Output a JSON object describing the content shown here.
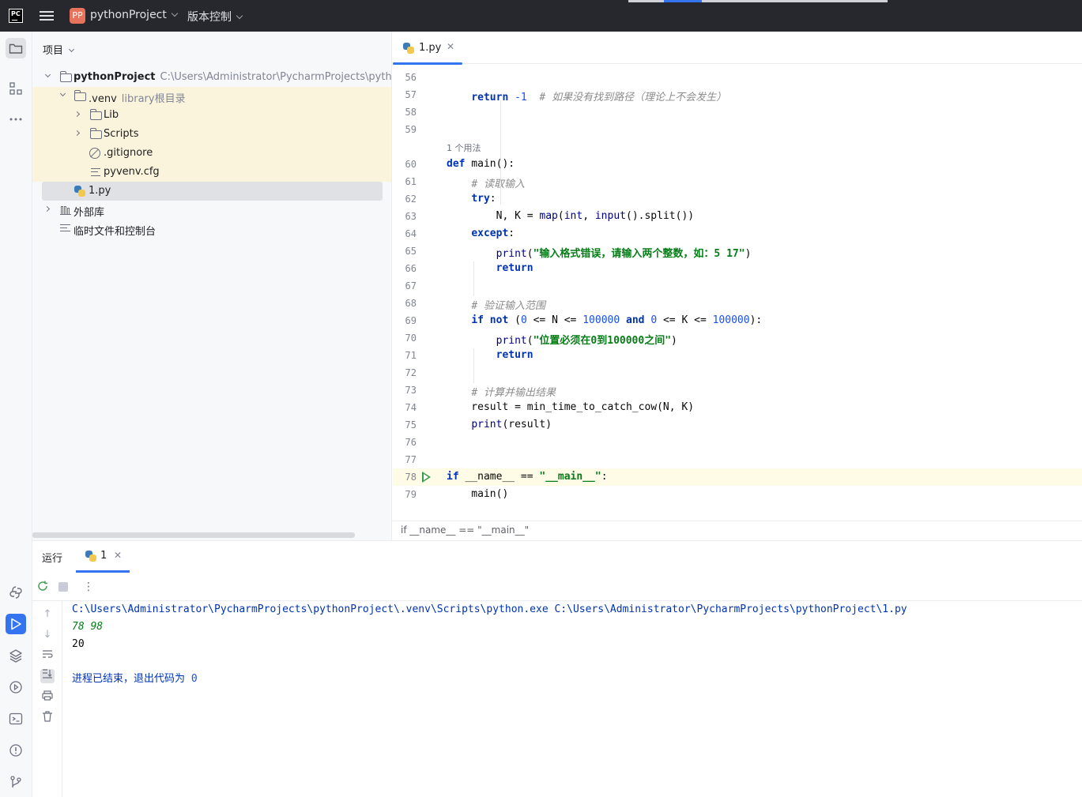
{
  "app": {
    "logo_text": "PC",
    "project_badge": "PP",
    "project_name": "pythonProject",
    "vcs_menu": "版本控制"
  },
  "project_panel": {
    "title": "项目",
    "root": {
      "name": "pythonProject",
      "path": "C:\\Users\\Administrator\\PycharmProjects\\pythonP"
    },
    "venv": {
      "name": ".venv",
      "hint": "library根目录"
    },
    "items": [
      {
        "name": "Lib",
        "type": "folder"
      },
      {
        "name": "Scripts",
        "type": "folder"
      },
      {
        "name": ".gitignore",
        "type": "gitignore"
      },
      {
        "name": "pyvenv.cfg",
        "type": "config"
      }
    ],
    "file": "1.py",
    "external_libs": "外部库",
    "scratches": "临时文件和控制台"
  },
  "editor": {
    "tab_label": "1.py",
    "usages_hint": "1 个用法",
    "breadcrumb": "if __name__ == \"__main__\"",
    "lines": [
      {
        "n": "56",
        "html": ""
      },
      {
        "n": "57",
        "html": "    <span class='kw'>return</span> <span class='num'>-1</span>  <span class='cmt'># 如果没有找到路径（理论上不会发生）</span>"
      },
      {
        "n": "58",
        "html": ""
      },
      {
        "n": "59",
        "html": ""
      },
      {
        "n": "60",
        "html": "<span class='kw'>def</span> main():"
      },
      {
        "n": "61",
        "html": "    <span class='cmt'># 读取输入</span>"
      },
      {
        "n": "62",
        "html": "    <span class='kw'>try</span>:"
      },
      {
        "n": "63",
        "html": "        N, K = <span class='bi'>map</span>(<span class='bi'>int</span>, <span class='bi'>input</span>().split())"
      },
      {
        "n": "64",
        "html": "    <span class='kw'>except</span>:"
      },
      {
        "n": "65",
        "html": "        <span class='bi'>print</span>(<span class='str'>\"输入格式错误，请输入两个整数，如：5 17\"</span>)"
      },
      {
        "n": "66",
        "html": "        <span class='kw'>return</span>"
      },
      {
        "n": "67",
        "html": ""
      },
      {
        "n": "68",
        "html": "    <span class='cmt'># 验证输入范围</span>"
      },
      {
        "n": "69",
        "html": "    <span class='kw'>if not</span> (<span class='num'>0</span> &lt;= N &lt;= <span class='num'>100000</span> <span class='kw'>and</span> <span class='num'>0</span> &lt;= K &lt;= <span class='num'>100000</span>):"
      },
      {
        "n": "70",
        "html": "        <span class='bi'>print</span>(<span class='str'>\"位置必须在0到100000之间\"</span>)"
      },
      {
        "n": "71",
        "html": "        <span class='kw'>return</span>"
      },
      {
        "n": "72",
        "html": ""
      },
      {
        "n": "73",
        "html": "    <span class='cmt'># 计算并输出结果</span>"
      },
      {
        "n": "74",
        "html": "    result = min_time_to_catch_cow(N, K)"
      },
      {
        "n": "75",
        "html": "    <span class='bi'>print</span>(result)"
      },
      {
        "n": "76",
        "html": ""
      },
      {
        "n": "77",
        "html": ""
      },
      {
        "n": "78",
        "html": "<span class='kw'>if</span> __name__ == <span class='str'>\"__main__\"</span>:"
      },
      {
        "n": "79",
        "html": "    main()"
      }
    ]
  },
  "run_panel": {
    "title": "运行",
    "tab_label": "1",
    "console": {
      "command": "C:\\Users\\Administrator\\PycharmProjects\\pythonProject\\.venv\\Scripts\\python.exe C:\\Users\\Administrator\\PycharmProjects\\pythonProject\\1.py",
      "input": "78 98",
      "output": "20",
      "exit_text": "进程已结束，退出代码为 ",
      "exit_code": "0"
    }
  },
  "colors": {
    "accent": "#3574f0",
    "title_bar": "#27282e",
    "keyword": "#0033b3",
    "string": "#067d17",
    "comment": "#8c8c8c",
    "project_badge": "#e8735d"
  }
}
